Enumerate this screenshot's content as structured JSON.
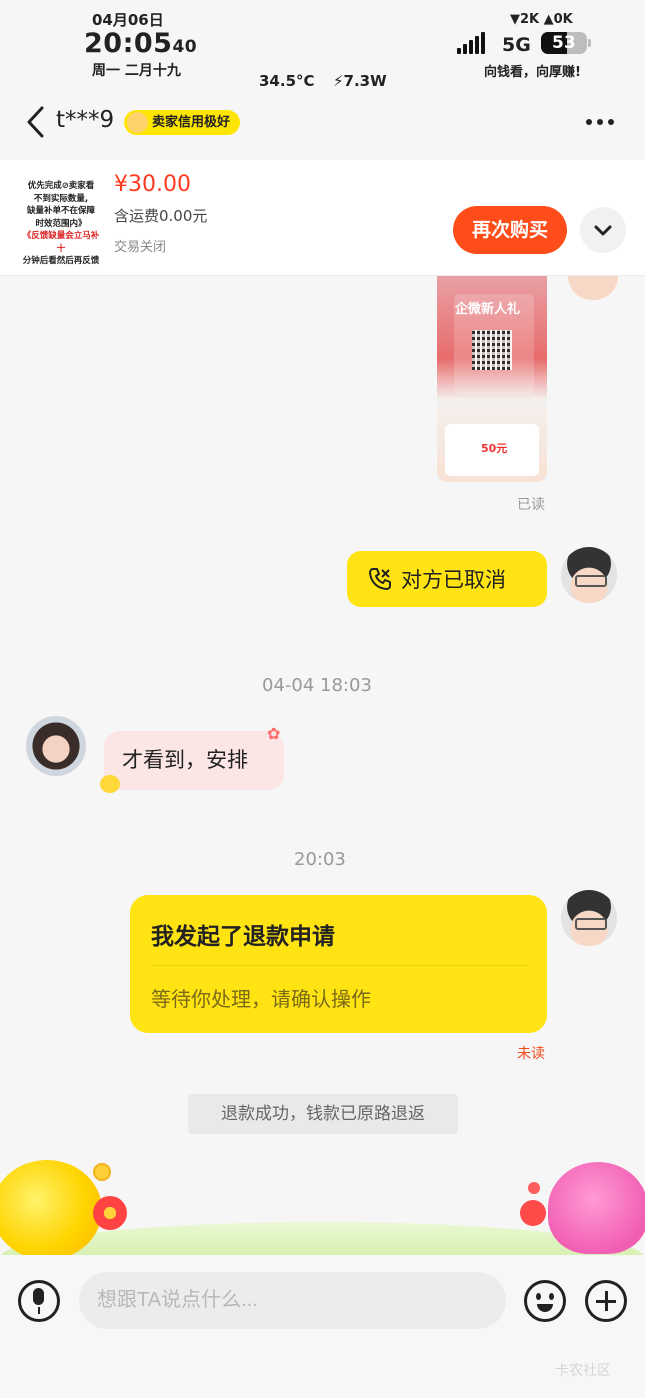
{
  "status_bar": {
    "date": "04月06日",
    "time_main": "20:05",
    "time_seconds": "40",
    "lunar": "周一 二月十九",
    "temperature": "34.5°C",
    "power": "⚡7.3W",
    "net_speed": "▼2K ▲0K",
    "network": "5G",
    "battery": "53",
    "promo": "向钱看，向厚赚!"
  },
  "header": {
    "peer_name": "t***9",
    "credit_badge": "卖家信用极好"
  },
  "product": {
    "thumb_lines": [
      "优先完成",
      "卖家看",
      "不到实际数量,",
      "缺量补单不在保障",
      "时效范围内》",
      "《反馈缺量会立马补十",
      "分钟后看然后再反馈"
    ],
    "price": "¥30.00",
    "shipping": "含运费0.00元",
    "status": "交易关闭",
    "rebuy_label": "再次购买"
  },
  "messages": {
    "image_title": "企微新人礼",
    "image_amount": "50元",
    "read_label": "已读",
    "call_text": "对方已取消",
    "time1": "04-04 18:03",
    "incoming_text": "才看到，安排",
    "time2": "20:03",
    "refund_title": "我发起了退款申请",
    "refund_subtitle": "等待你处理，请确认操作",
    "unread_label": "未读",
    "system_text": "退款成功，钱款已原路退返"
  },
  "input": {
    "placeholder": "想跟TA说点什么..."
  },
  "watermark": "卡农社区",
  "colors": {
    "accent_yellow": "#ffe312",
    "price_red": "#ff3b1f",
    "rebuy_orange": "#ff4d1a"
  }
}
